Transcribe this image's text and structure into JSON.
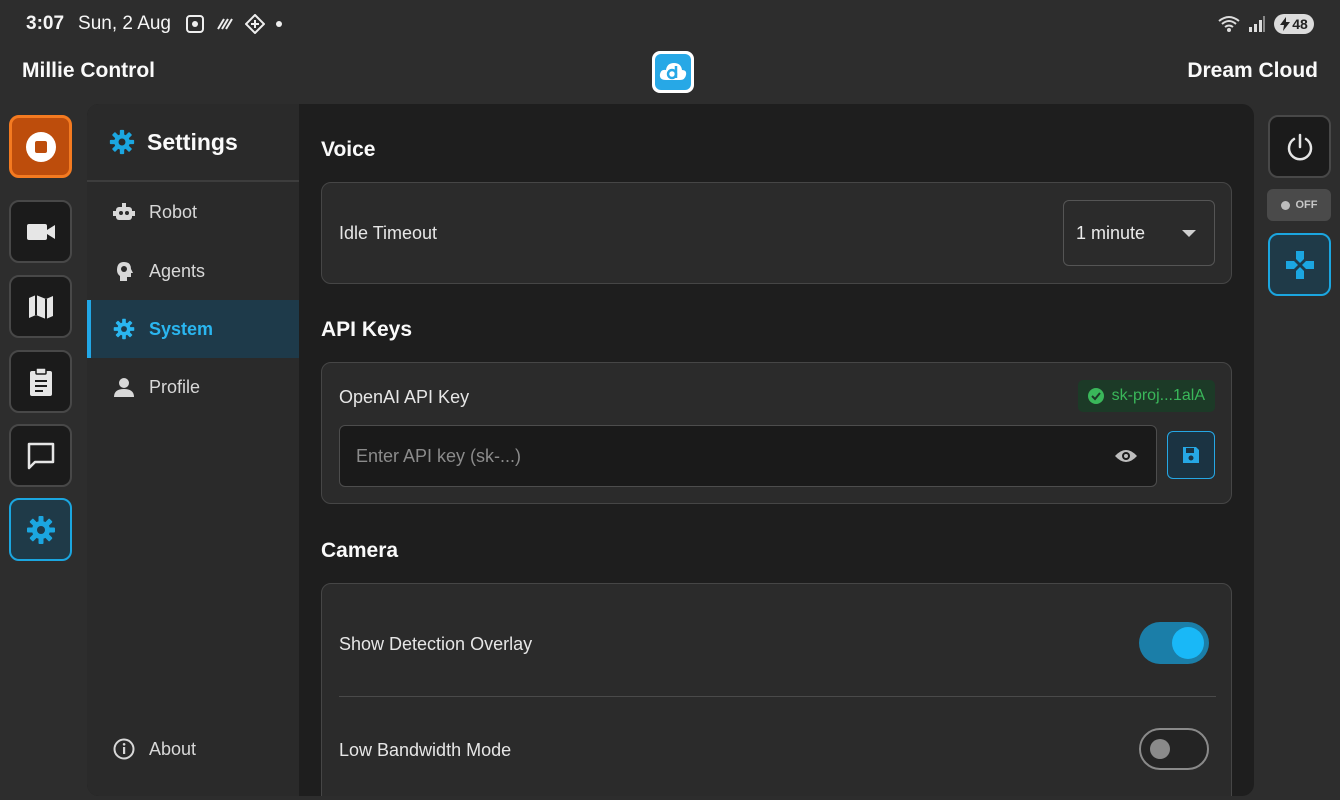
{
  "status_bar": {
    "time": "3:07",
    "date": "Sun, 2 Aug",
    "battery": "48"
  },
  "app_bar": {
    "title_left": "Millie Control",
    "title_right": "Dream Cloud",
    "logo_icon": "dream-cloud-logo"
  },
  "left_rail": {
    "items": [
      {
        "icon": "stop-icon",
        "state": "emergency"
      },
      {
        "icon": "videocam-icon"
      },
      {
        "icon": "map-icon"
      },
      {
        "icon": "clipboard-icon"
      },
      {
        "icon": "chat-icon"
      },
      {
        "icon": "gear-icon",
        "state": "active"
      }
    ]
  },
  "settings_nav": {
    "title": "Settings",
    "items": [
      {
        "label": "Robot",
        "icon": "robot-icon"
      },
      {
        "label": "Agents",
        "icon": "agent-head-icon"
      },
      {
        "label": "System",
        "icon": "gear-icon",
        "active": true
      },
      {
        "label": "Profile",
        "icon": "person-icon"
      }
    ],
    "about": {
      "label": "About",
      "icon": "info-icon"
    }
  },
  "voice": {
    "section_title": "Voice",
    "idle_timeout_label": "Idle Timeout",
    "idle_timeout_value": "1 minute"
  },
  "api_keys": {
    "section_title": "API Keys",
    "openai_label": "OpenAI API Key",
    "saved_key": "sk-proj...1alA",
    "input_placeholder": "Enter API key (sk-...)"
  },
  "camera": {
    "section_title": "Camera",
    "detection_overlay_label": "Show Detection Overlay",
    "detection_overlay_on": true,
    "low_bandwidth_label": "Low Bandwidth Mode",
    "low_bandwidth_on": false
  },
  "right_rail": {
    "power_icon": "power-icon",
    "off_label": "OFF",
    "gamepad_icon": "gamepad-icon"
  },
  "colors": {
    "accent": "#1ba6e0",
    "stop": "#bd4d0c",
    "success": "#3ab75a",
    "background": "#2d2d2d",
    "panel": "#1e1e1e"
  }
}
